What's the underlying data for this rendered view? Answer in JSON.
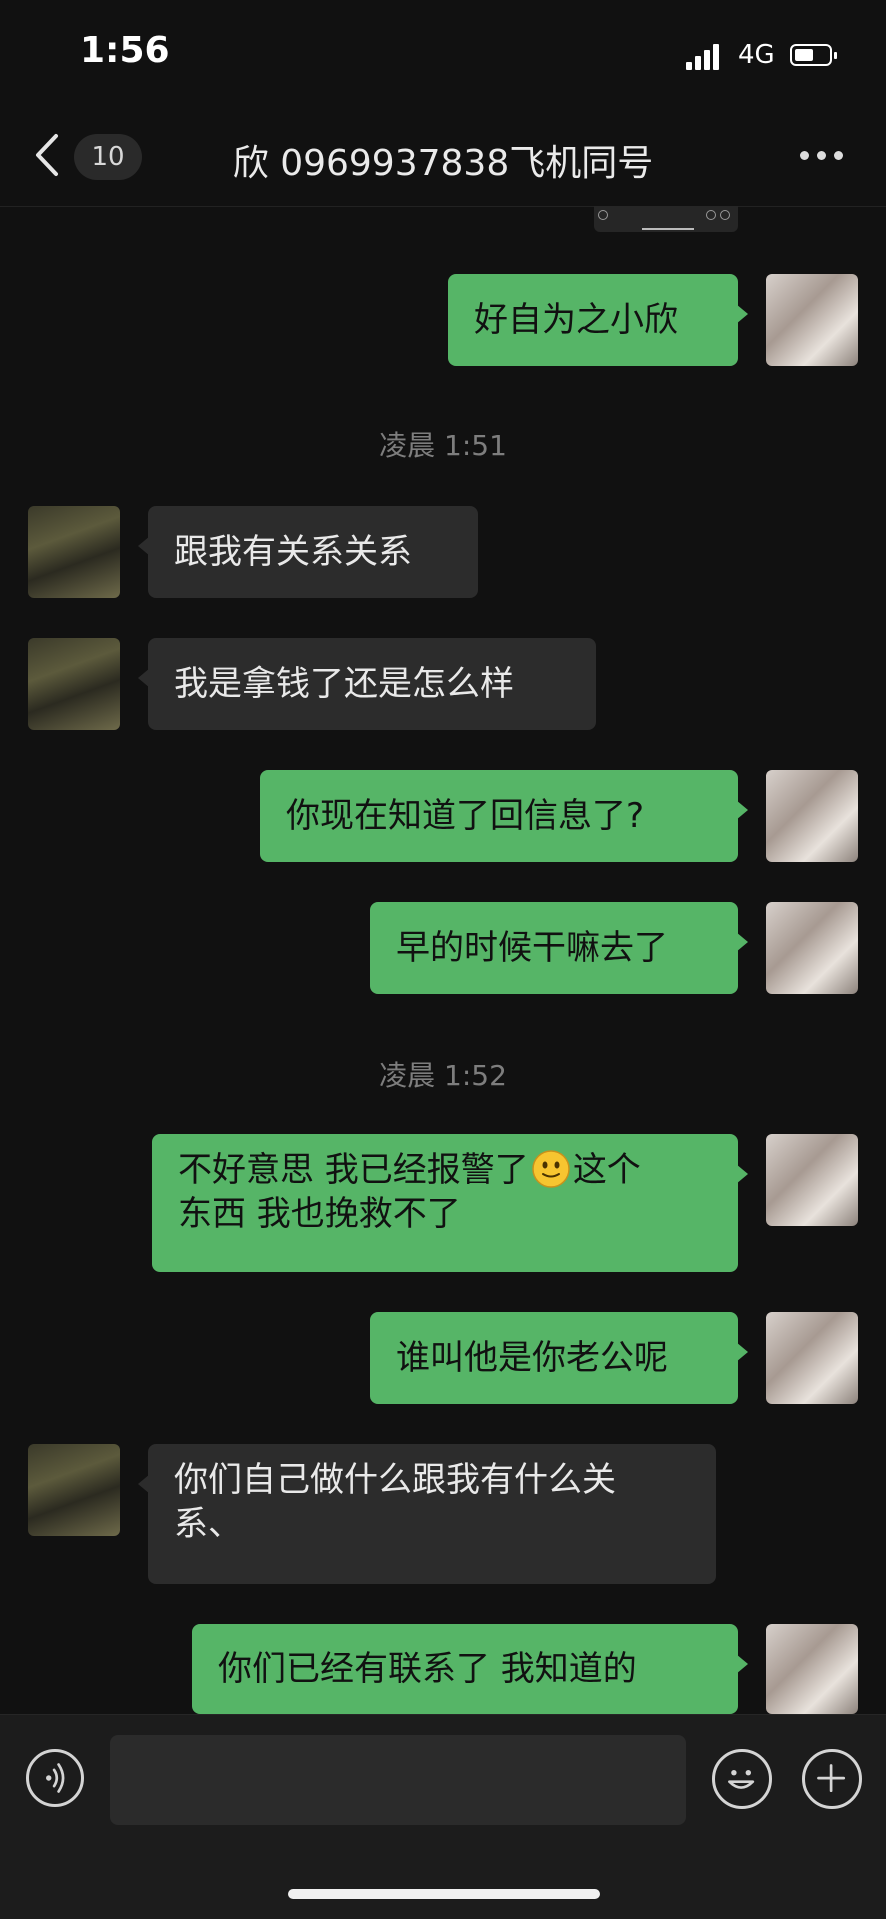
{
  "status_bar": {
    "time": "1:56",
    "network": "4G"
  },
  "header": {
    "unread_count": "10",
    "title": "欣 0969937838飞机同号"
  },
  "timestamps": [
    "凌晨 1:51",
    "凌晨 1:52"
  ],
  "messages": [
    {
      "side": "mine",
      "text": "好自为之小欣"
    },
    {
      "side": "theirs",
      "text": "跟我有关系关系"
    },
    {
      "side": "theirs",
      "text": "我是拿钱了还是怎么样"
    },
    {
      "side": "mine",
      "text": "你现在知道了回信息了?"
    },
    {
      "side": "mine",
      "text": "早的时候干嘛去了"
    },
    {
      "side": "mine",
      "line1_a": "不好意思 我已经报警了",
      "line1_b": "这个",
      "line2": "东西 我也挽救不了",
      "emoji": "smile-emoji"
    },
    {
      "side": "mine",
      "text": "谁叫他是你老公呢"
    },
    {
      "side": "theirs",
      "line1": "你们自己做什么跟我有什么关",
      "line2": "系、"
    },
    {
      "side": "mine",
      "text": "你们已经有联系了 我知道的"
    }
  ],
  "colors": {
    "my_bubble": "#56b567",
    "their_bubble": "#2c2c2c",
    "background": "#111111"
  },
  "icons": [
    "back-chevron-icon",
    "more-dots-icon",
    "voice-icon",
    "emoji-icon",
    "plus-icon"
  ]
}
